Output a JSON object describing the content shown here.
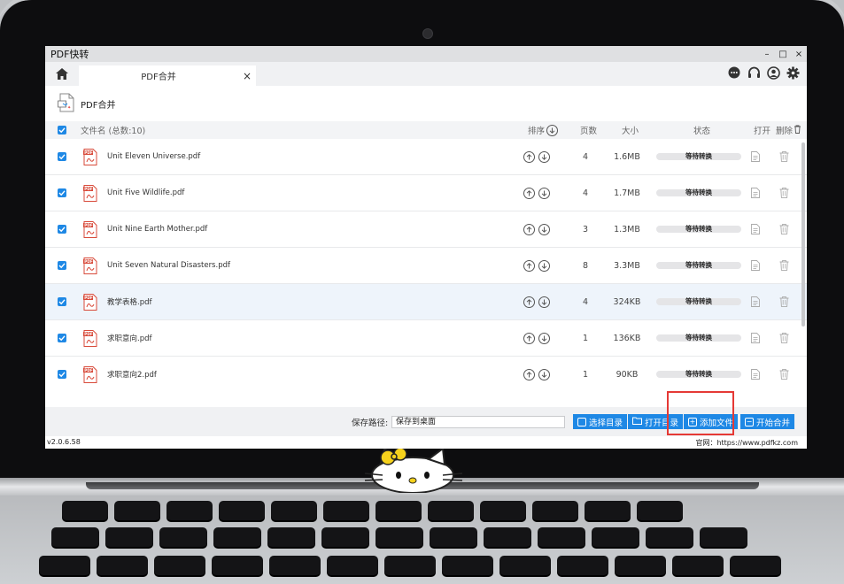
{
  "window": {
    "title": "PDF快转",
    "controls": [
      "–",
      "□",
      "×"
    ]
  },
  "tabs": [
    {
      "label": "PDF合并",
      "close": "×"
    }
  ],
  "section_title": "PDF合并",
  "list": {
    "header": {
      "filename": "文件名 (总数:10)",
      "sort": "排序",
      "pages": "页数",
      "size": "大小",
      "status": "状态",
      "open": "打开",
      "delete": "删除"
    },
    "files": [
      {
        "name": "Unit Eleven Universe.pdf",
        "pages": "4",
        "size": "1.6MB",
        "status": "等待转换"
      },
      {
        "name": "Unit Five Wildlife.pdf",
        "pages": "4",
        "size": "1.7MB",
        "status": "等待转换"
      },
      {
        "name": "Unit Nine Earth Mother.pdf",
        "pages": "3",
        "size": "1.3MB",
        "status": "等待转换"
      },
      {
        "name": "Unit Seven Natural Disasters.pdf",
        "pages": "8",
        "size": "3.3MB",
        "status": "等待转换"
      },
      {
        "name": "教学表格.pdf",
        "pages": "4",
        "size": "324KB",
        "status": "等待转换"
      },
      {
        "name": "求职意向.pdf",
        "pages": "1",
        "size": "136KB",
        "status": "等待转换"
      },
      {
        "name": "求职意向2.pdf",
        "pages": "1",
        "size": "90KB",
        "status": "等待转换"
      }
    ]
  },
  "bottom": {
    "save_path_label": "保存路径:",
    "save_path_value": "保存到桌面",
    "btn_choose_dir": "选择目录",
    "btn_open_dir": "打开目录",
    "btn_add_file": "添加文件",
    "btn_start_merge": "开始合并"
  },
  "statusline": {
    "version": "v2.0.6.58",
    "website": "官网：https://www.pdfkz.com"
  },
  "colors": {
    "accent": "#1e88e5",
    "highlight_box": "#e53935"
  }
}
